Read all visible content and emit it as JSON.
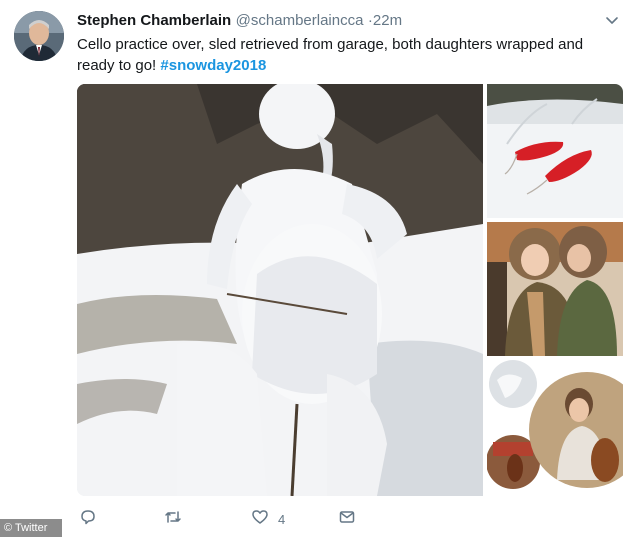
{
  "tweet": {
    "author_name": "Stephen Chamberlain",
    "handle": "@schamberlaincca",
    "separator": "·",
    "time": "22m",
    "text_prefix": "Cello practice over, sled retrieved from garage, both daughters wrapped and ready to go! ",
    "hashtag": "#snowday2018"
  },
  "media": {
    "photos": [
      {
        "name": "snow-cellist-sculpture"
      },
      {
        "name": "red-sleds-in-snow"
      },
      {
        "name": "daughters-in-winter-coats"
      },
      {
        "name": "cello-practice-collage"
      }
    ]
  },
  "actions": {
    "reply_icon": "reply-icon",
    "retweet_icon": "retweet-icon",
    "like_icon": "heart-icon",
    "like_count": "4",
    "dm_icon": "envelope-icon"
  },
  "watermark": "© Twitter",
  "colors": {
    "hashtag": "#1b95e0",
    "secondary_text": "#657786",
    "primary_text": "#14171a"
  }
}
